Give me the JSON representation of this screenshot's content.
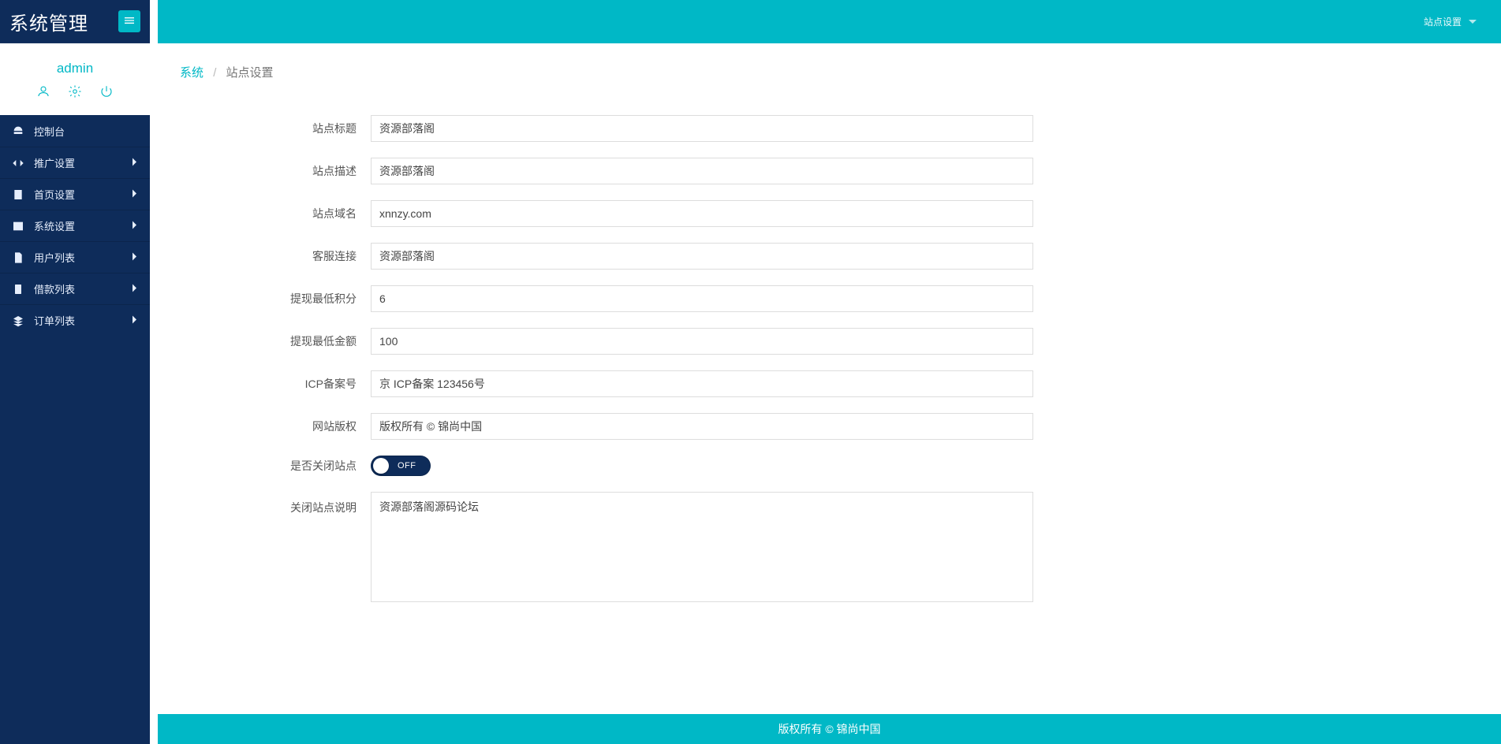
{
  "sidebar": {
    "brand": "系统管理",
    "items": [
      {
        "label": "控制台"
      },
      {
        "label": "推广设置"
      },
      {
        "label": "首页设置"
      },
      {
        "label": "系统设置"
      },
      {
        "label": "用户列表"
      },
      {
        "label": "借款列表"
      },
      {
        "label": "订单列表"
      }
    ]
  },
  "profile": {
    "name": "admin"
  },
  "topbar": {
    "tab": "站点设置"
  },
  "breadcrumb": {
    "root": "系统",
    "active": "站点设置"
  },
  "form": {
    "site_title": {
      "label": "站点标题",
      "value": "资源部落阁"
    },
    "site_desc": {
      "label": "站点描述",
      "value": "资源部落阁"
    },
    "site_domain": {
      "label": "站点域名",
      "value": "xnnzy.com"
    },
    "kefu_link": {
      "label": "客服连接",
      "value": "资源部落阁"
    },
    "min_points": {
      "label": "提现最低积分",
      "value": "6"
    },
    "min_amount": {
      "label": "提现最低金额",
      "value": "100"
    },
    "icp": {
      "label": "ICP备案号",
      "value": "京 ICP备案 123456号"
    },
    "copyright": {
      "label": "网站版权",
      "value": "版权所有 © 锦尚中国"
    },
    "closed": {
      "label": "是否关闭站点",
      "state": "OFF"
    },
    "closed_msg": {
      "label": "关闭站点说明",
      "value": "资源部落阁源码论坛"
    }
  },
  "footer": {
    "text": "版权所有 © 锦尚中国"
  }
}
